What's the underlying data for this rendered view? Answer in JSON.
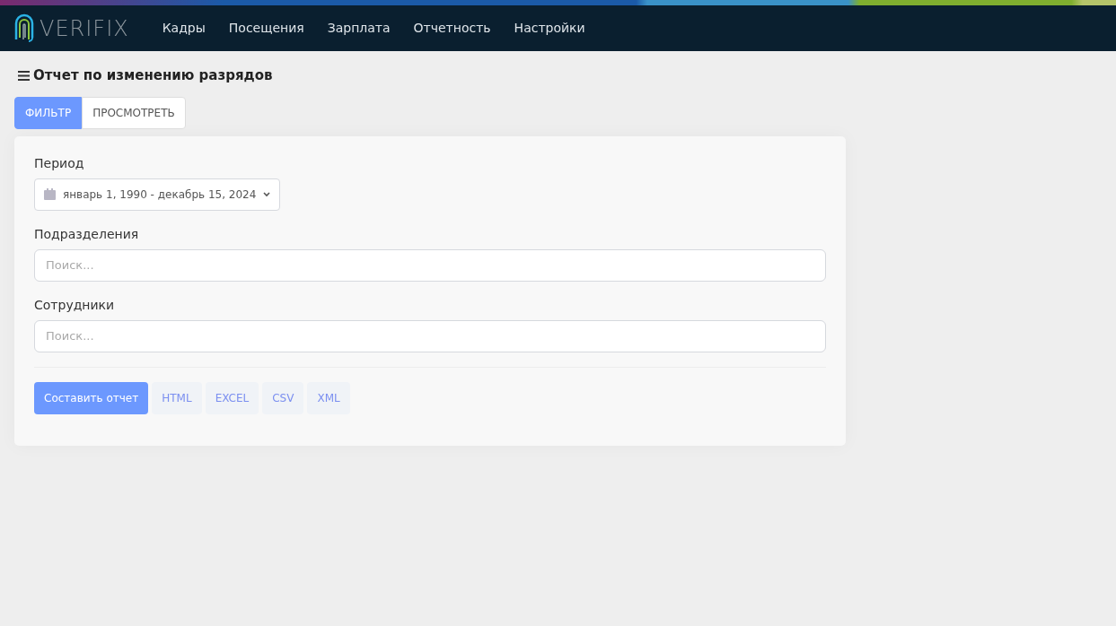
{
  "brand": "VERIFIX",
  "nav": [
    "Кадры",
    "Посещения",
    "Зарплата",
    "Отчетность",
    "Настройки"
  ],
  "page_title": "Отчет по изменению разрядов",
  "tabs": [
    {
      "label": "ФИЛЬТР",
      "selected": true
    },
    {
      "label": "ПРОСМОТРЕТЬ",
      "selected": false
    }
  ],
  "fields": [
    {
      "kind": "daterange",
      "label": "Период",
      "value": "январь 1, 1990 - декабрь 15, 2024"
    },
    {
      "kind": "search",
      "label": "Подразделения",
      "placeholder": "Поиск..."
    },
    {
      "kind": "search",
      "label": "Сотрудники",
      "placeholder": "Поиск..."
    }
  ],
  "buttons": [
    {
      "label": "Составить отчет",
      "kind": "primary"
    },
    {
      "label": "HTML",
      "kind": "light"
    },
    {
      "label": "EXCEL",
      "kind": "light"
    },
    {
      "label": "CSV",
      "kind": "light"
    },
    {
      "label": "XML",
      "kind": "light"
    }
  ]
}
